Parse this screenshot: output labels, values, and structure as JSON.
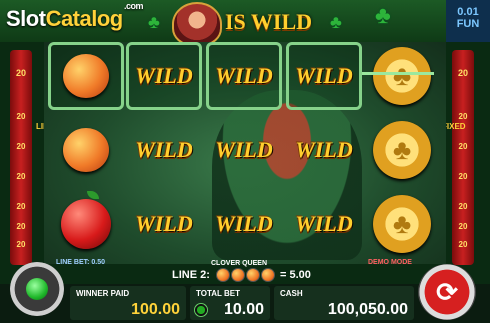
{
  "header": {
    "logo_slot": "Slot",
    "logo_catalog": "Catalog",
    "logo_com": ".com",
    "title": "IS WILD",
    "coin_value": "0.01",
    "coin_unit": "FUN"
  },
  "left_side": {
    "numbers": [
      "20",
      "20",
      "20",
      "20",
      "20",
      "20",
      "20"
    ],
    "label": "LINES"
  },
  "right_side": {
    "numbers": [
      "20",
      "20",
      "20",
      "20",
      "20",
      "20",
      "20"
    ],
    "label": "FIXED"
  },
  "reels": {
    "wild_text": "WILD",
    "grid": [
      [
        "peach",
        "wild",
        "wild",
        "wild",
        "coin"
      ],
      [
        "peach",
        "wild",
        "wild",
        "wild",
        "coin"
      ],
      [
        "apple",
        "wild",
        "wild",
        "wild",
        "coin"
      ]
    ],
    "highlighted": [
      [
        0,
        0
      ],
      [
        0,
        1
      ],
      [
        0,
        2
      ],
      [
        0,
        3
      ]
    ]
  },
  "info": {
    "line_bet": "LINE BET: 0.50",
    "demo_mode": "DEMO MODE",
    "symbol_name": "CLOVER QUEEN",
    "line_label": "LINE 2:",
    "line_win": "= 5.00"
  },
  "bottom": {
    "winner_paid_label": "WINNER PAID",
    "winner_paid_value": "100.00",
    "total_bet_label": "TOTAL BET",
    "total_bet_value": "10.00",
    "cash_label": "CASH",
    "cash_value": "100,050.00"
  },
  "colors": {
    "frame": "#86d28a",
    "wild": "#ffcf2e",
    "side_bar": "#c82020",
    "accent_yellow": "#ffd23a"
  }
}
